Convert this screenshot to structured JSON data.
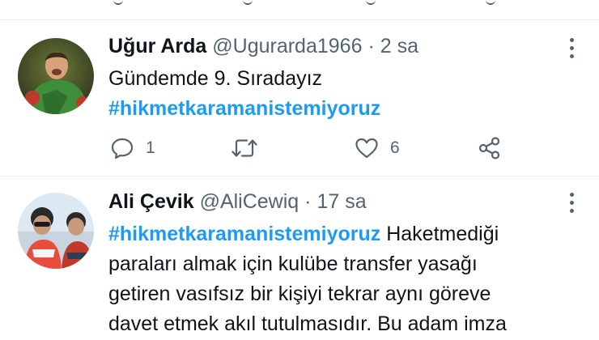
{
  "tweets": [
    {
      "name": "Uğur Arda",
      "handle": "@Ugurarda1966",
      "separator": "·",
      "time": "2 sa",
      "text": "Gündemde 9. Sıradayız",
      "hashtag": "#hikmetkaramanistemiyoruz",
      "replies": "1",
      "retweets": "",
      "likes": "6"
    },
    {
      "name": "Ali Çevik",
      "handle": "@AliCewiq",
      "separator": "·",
      "time": "17 sa",
      "hashtag": "#hikmetkaramanistemiyoruz",
      "text_after_hashtag": " Haketmediği",
      "text_lines": [
        "paraları almak için kulübe transfer yasağı",
        "getiren vasıfsız bir kişiyi tekrar aynı göreve",
        "davet etmek akıl tutulmasıdır. Bu adam imza"
      ]
    }
  ],
  "colors": {
    "hashtag": "#1d9bf0",
    "secondary": "#536471",
    "divider": "#e6ecf0"
  },
  "icons": [
    "reply-icon",
    "retweet-icon",
    "like-icon",
    "share-icon",
    "more-icon"
  ]
}
